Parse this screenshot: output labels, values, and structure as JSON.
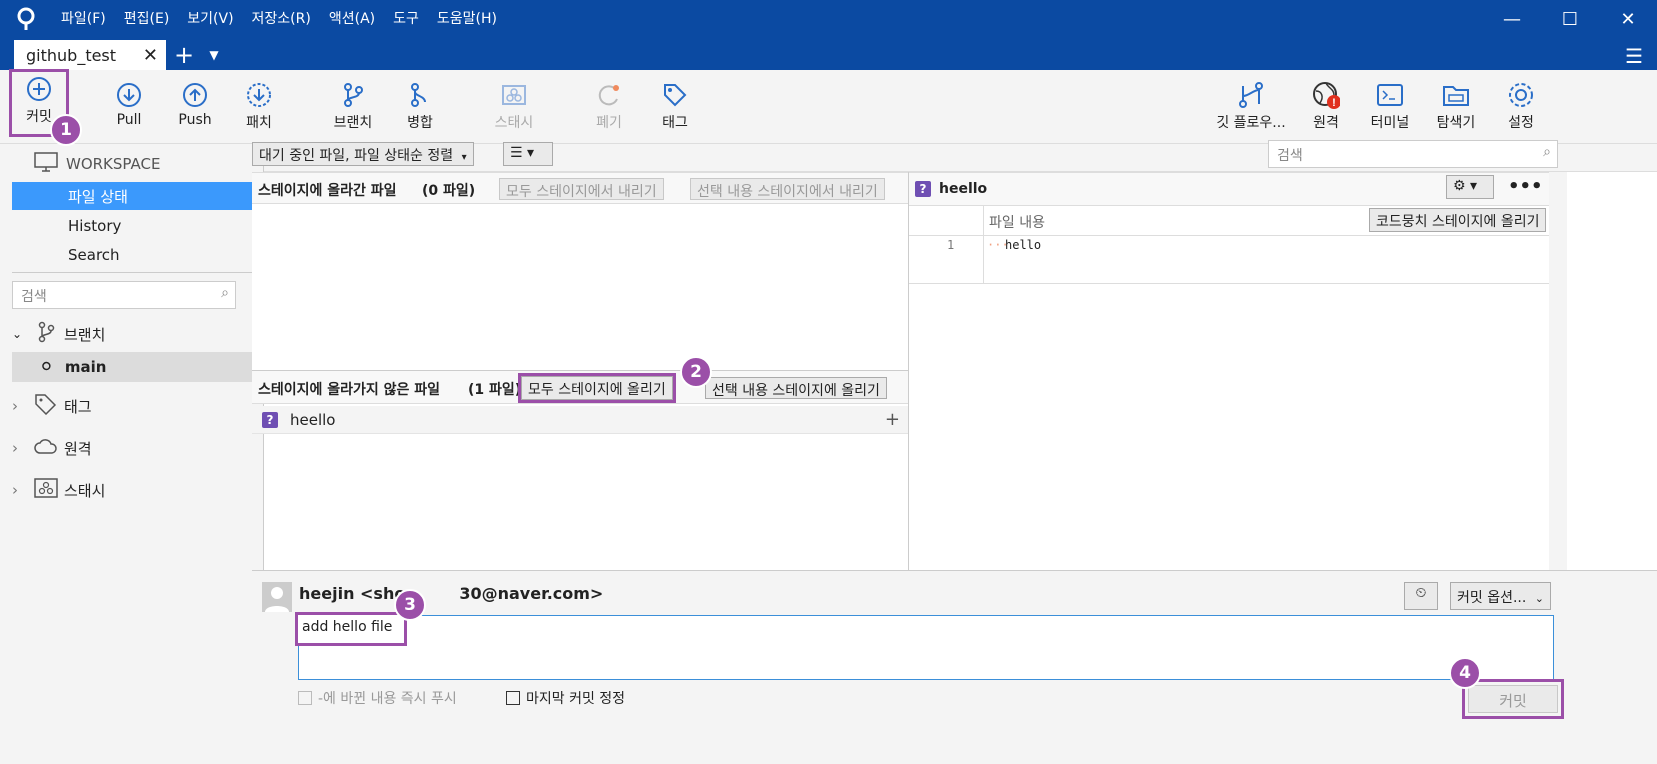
{
  "menu": {
    "items": [
      "파일(F)",
      "편집(E)",
      "보기(V)",
      "저장소(R)",
      "액션(A)",
      "도구",
      "도움말(H)"
    ]
  },
  "tab": {
    "label": "github_test"
  },
  "toolbar": {
    "commit": "커밋",
    "pull": "Pull",
    "push": "Push",
    "fetch": "패치",
    "branch": "브랜치",
    "merge": "병합",
    "stash": "스태시",
    "discard": "폐기",
    "tag": "태그",
    "gitflow": "깃 플로우...",
    "remote": "원격",
    "terminal": "터미널",
    "explorer": "탐색기",
    "settings": "설정"
  },
  "sidebar": {
    "workspace": "WORKSPACE",
    "file_status": "파일 상태",
    "history": "History",
    "search": "Search",
    "search_placeholder": "검색",
    "branches": "브랜치",
    "main_branch": "main",
    "tags": "태그",
    "remotes": "원격",
    "stashes": "스태시"
  },
  "filter": {
    "sort": "대기 중인 파일, 파일 상태순 정렬",
    "search_placeholder": "검색"
  },
  "staged": {
    "title": "스테이지에 올라간 파일",
    "count": "(0 파일)",
    "unstage_all": "모두 스테이지에서 내리기",
    "unstage_selected": "선택 내용 스테이지에서 내리기"
  },
  "unstaged": {
    "title": "스테이지에 올라가지 않은 파일",
    "count": "(1 파일)",
    "stage_all": "모두 스테이지에 올리기",
    "stage_selected": "선택 내용 스테이지에 올리기",
    "file": "heello"
  },
  "diff": {
    "filename": "heello",
    "header": "파일 내용",
    "stage_hunk": "코드뭉치 스테이지에 올리기",
    "line_no": "1",
    "line_text": "hello"
  },
  "commit": {
    "author": "heejin <sho",
    "author_tail": "30@naver.com>",
    "message": "add hello file",
    "options": "커밋 옵션...",
    "push_label": "-에 바뀐 내용 즉시 푸시",
    "amend_label": "마지막 커밋 정정",
    "commit_button": "커밋"
  },
  "badges": [
    "1",
    "2",
    "3",
    "4"
  ],
  "colors": {
    "brand": "#0b4aa2",
    "highlight": "#9b4fa8",
    "selected": "#3b99fc"
  }
}
